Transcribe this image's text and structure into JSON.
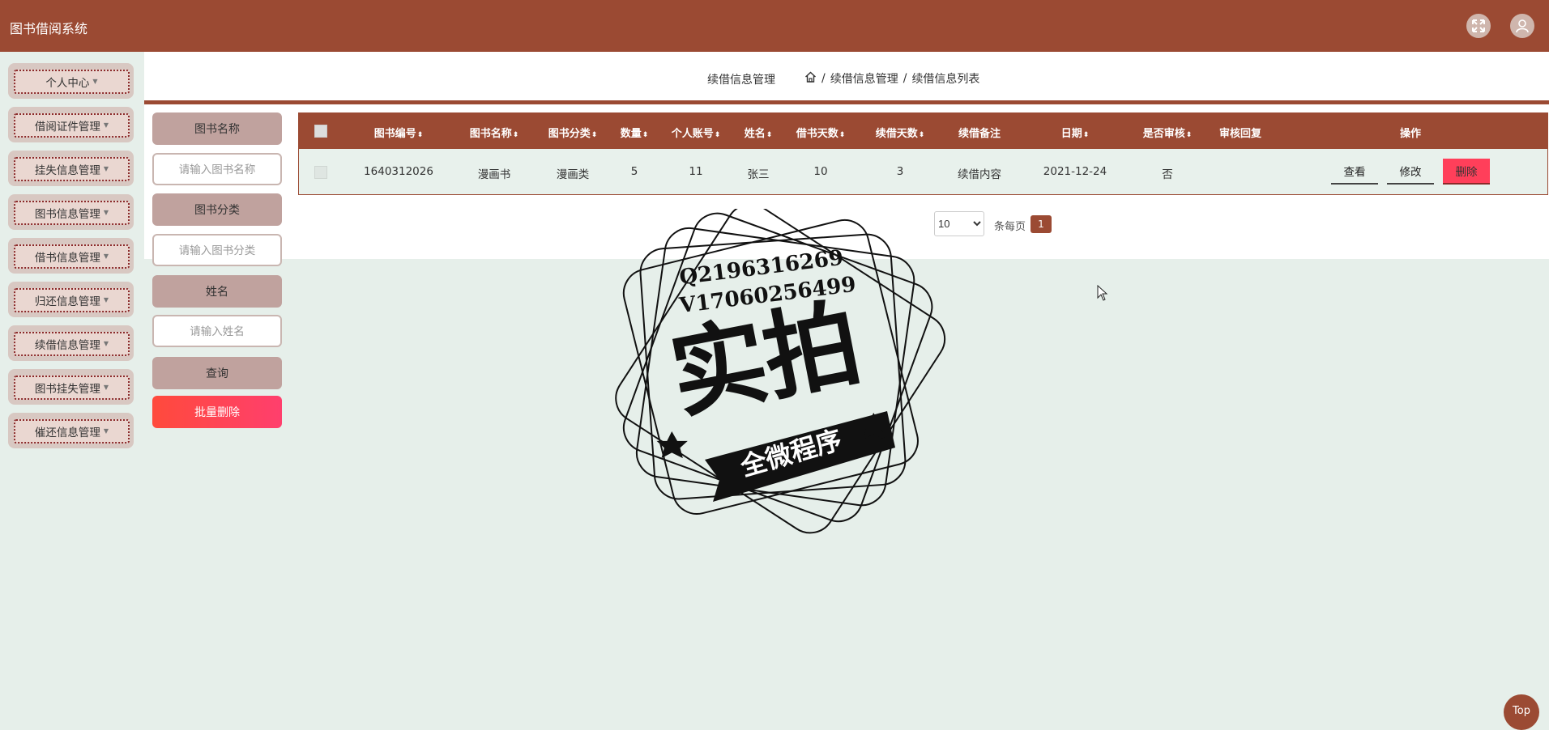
{
  "header": {
    "title": "图书借阅系统",
    "fullscreen_icon": "fullscreen-icon",
    "user_icon": "user-icon"
  },
  "sidebar": {
    "items": [
      {
        "label": "个人中心"
      },
      {
        "label": "借阅证件管理"
      },
      {
        "label": "挂失信息管理"
      },
      {
        "label": "图书信息管理"
      },
      {
        "label": "借书信息管理"
      },
      {
        "label": "归还信息管理"
      },
      {
        "label": "续借信息管理"
      },
      {
        "label": "图书挂失管理"
      },
      {
        "label": "催还信息管理"
      }
    ]
  },
  "breadcrumb": {
    "page_title": "续借信息管理",
    "trail1": "续借信息管理",
    "sep": "/",
    "trail2": "续借信息列表",
    "home_icon": "home-icon"
  },
  "filters": {
    "book_name_label": "图书名称",
    "book_name_placeholder": "请输入图书名称",
    "book_category_label": "图书分类",
    "book_category_placeholder": "请输入图书分类",
    "name_label": "姓名",
    "name_placeholder": "请输入姓名",
    "query_button": "查询",
    "batch_delete_button": "批量删除"
  },
  "table": {
    "columns": [
      "图书编号",
      "图书名称",
      "图书分类",
      "数量",
      "个人账号",
      "姓名",
      "借书天数",
      "续借天数",
      "续借备注",
      "日期",
      "是否审核",
      "审核回复",
      "操作"
    ],
    "rows": [
      {
        "book_no": "1640312026",
        "book_name": "漫画书",
        "category": "漫画类",
        "quantity": "5",
        "account": "11",
        "name": "张三",
        "borrow_days": "10",
        "renew_days": "3",
        "remark": "续借内容",
        "date": "2021-12-24",
        "reviewed": "否",
        "reply": "",
        "actions": {
          "view": "查看",
          "edit": "修改",
          "delete": "删除"
        }
      }
    ]
  },
  "pagination": {
    "page_size": "10",
    "page_size_options": [
      "10"
    ],
    "per_page_label": "条每页",
    "current_page": "1"
  },
  "watermark": {
    "line1": "Q2196316269",
    "line2": "V17060256499",
    "big": "实拍",
    "ribbon": "全微程序"
  },
  "top_button": "Top",
  "colors": {
    "brand": "#9b4a33",
    "delete": "#ff3f5a",
    "background": "#e6efea"
  }
}
